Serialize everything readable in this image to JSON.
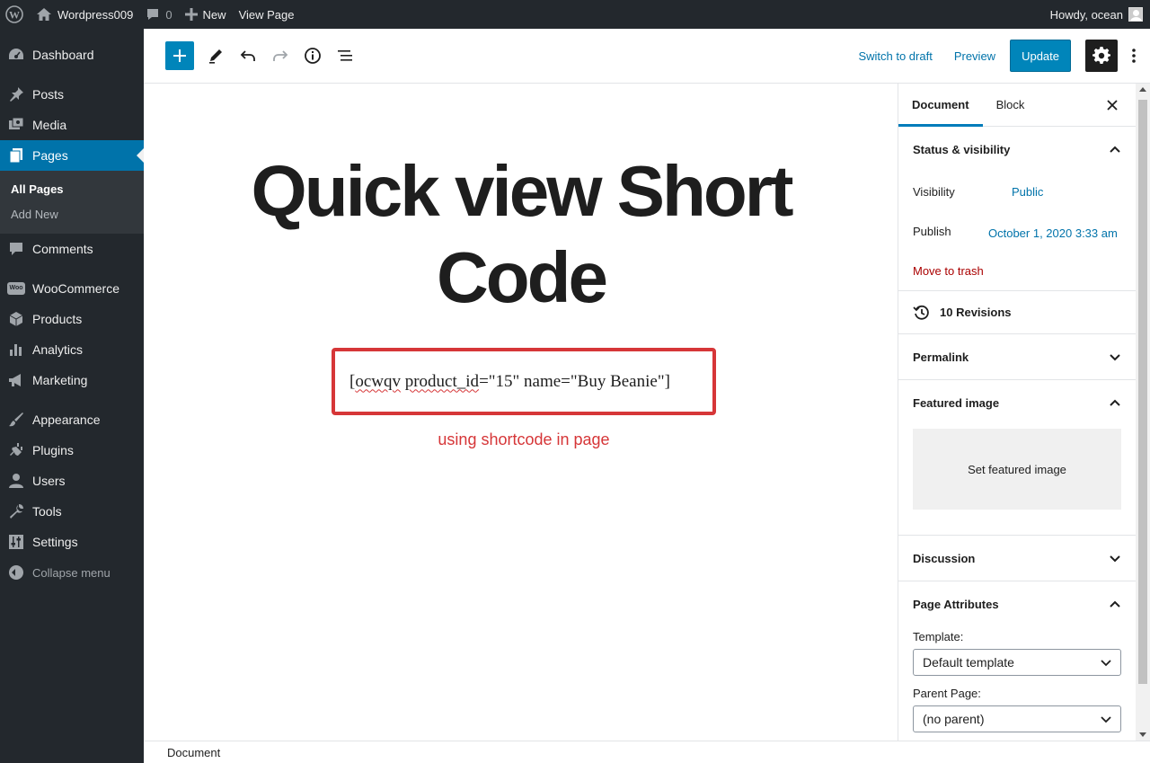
{
  "admin_bar": {
    "site_name": "Wordpress009",
    "comment_count": "0",
    "new_label": "New",
    "view_page_label": "View Page",
    "howdy": "Howdy, ocean"
  },
  "admin_menu": {
    "dashboard": "Dashboard",
    "posts": "Posts",
    "media": "Media",
    "pages": "Pages",
    "pages_sub": [
      "All Pages",
      "Add New"
    ],
    "comments": "Comments",
    "woocommerce": "WooCommerce",
    "woo_badge": "Woo",
    "products": "Products",
    "analytics": "Analytics",
    "marketing": "Marketing",
    "appearance": "Appearance",
    "plugins": "Plugins",
    "users": "Users",
    "tools": "Tools",
    "settings": "Settings",
    "collapse": "Collapse menu"
  },
  "toolbar": {
    "switch_to_draft": "Switch to draft",
    "preview": "Preview",
    "update": "Update"
  },
  "content": {
    "title": "Quick view Short Code",
    "shortcode_pre": "[",
    "shortcode_word1": "ocwqv",
    "shortcode_space": " ",
    "shortcode_word2": "product_id",
    "shortcode_post": "=\"15\" name=\"Buy Beanie\"]",
    "annotation": "using shortcode in page"
  },
  "footer": {
    "breadcrumb": "Document"
  },
  "sidebar": {
    "tabs": [
      "Document",
      "Block"
    ],
    "status_visibility": {
      "title": "Status & visibility",
      "visibility_label": "Visibility",
      "visibility_value": "Public",
      "publish_label": "Publish",
      "publish_value": "October 1, 2020 3:33 am",
      "trash": "Move to trash"
    },
    "revisions": "10 Revisions",
    "permalink": "Permalink",
    "featured_image": {
      "title": "Featured image",
      "button": "Set featured image"
    },
    "discussion": "Discussion",
    "page_attributes": {
      "title": "Page Attributes",
      "template_label": "Template:",
      "template_value": "Default template",
      "parent_label": "Parent Page:",
      "parent_value": "(no parent)"
    }
  },
  "colors": {
    "admin_dark": "#23282d",
    "wp_blue": "#0085ba",
    "link_blue": "#0073aa",
    "annotation_red": "#d63638",
    "trash_red": "#a00"
  }
}
